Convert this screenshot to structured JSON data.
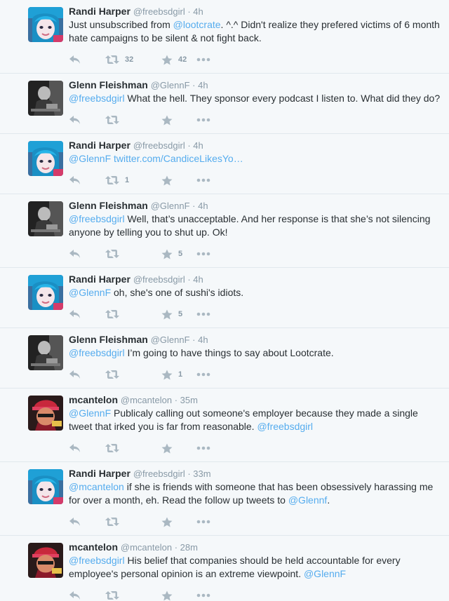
{
  "tweets": [
    {
      "name": "Randi Harper",
      "handle": "@freebsdgirl",
      "time": "4h",
      "avatar": "randi",
      "segments": [
        {
          "t": "Just unsubscribed from "
        },
        {
          "t": "@lootcrate",
          "link": true
        },
        {
          "t": ".  ^.^ Didn't realize they prefered victims of 6 month hate campaigns to be silent & not fight back."
        }
      ],
      "retweets": "32",
      "favorites": "42"
    },
    {
      "name": "Glenn Fleishman",
      "handle": "@GlennF",
      "time": "4h",
      "avatar": "glenn",
      "segments": [
        {
          "t": "@freebsdgirl",
          "link": true
        },
        {
          "t": " What the hell. They sponsor every podcast I listen to. What did they do?"
        }
      ],
      "retweets": "",
      "favorites": ""
    },
    {
      "name": "Randi Harper",
      "handle": "@freebsdgirl",
      "time": "4h",
      "avatar": "randi",
      "segments": [
        {
          "t": "@GlennF",
          "link": true
        },
        {
          "t": " "
        },
        {
          "t": "twitter.com/CandiceLikesYo…",
          "link": true
        }
      ],
      "retweets": "1",
      "favorites": ""
    },
    {
      "name": "Glenn Fleishman",
      "handle": "@GlennF",
      "time": "4h",
      "avatar": "glenn",
      "segments": [
        {
          "t": "@freebsdgirl",
          "link": true
        },
        {
          "t": " Well, that’s unacceptable. And her response is that she’s not silencing anyone by telling you to shut up. Ok!"
        }
      ],
      "retweets": "",
      "favorites": "5"
    },
    {
      "name": "Randi Harper",
      "handle": "@freebsdgirl",
      "time": "4h",
      "avatar": "randi",
      "segments": [
        {
          "t": "@GlennF",
          "link": true
        },
        {
          "t": " oh, she's one of sushi's idiots."
        }
      ],
      "retweets": "",
      "favorites": "5"
    },
    {
      "name": "Glenn Fleishman",
      "handle": "@GlennF",
      "time": "4h",
      "avatar": "glenn",
      "segments": [
        {
          "t": "@freebsdgirl",
          "link": true
        },
        {
          "t": " I’m going to have things to say about Lootcrate."
        }
      ],
      "retweets": "",
      "favorites": "1"
    },
    {
      "name": "mcantelon",
      "handle": "@mcantelon",
      "time": "35m",
      "avatar": "mcantelon",
      "segments": [
        {
          "t": "@GlennF",
          "link": true
        },
        {
          "t": " Publicaly calling out someone's employer because they made a single tweet that irked you is far from reasonable. "
        },
        {
          "t": "@freebsdgirl",
          "link": true
        }
      ],
      "retweets": "",
      "favorites": ""
    },
    {
      "name": "Randi Harper",
      "handle": "@freebsdgirl",
      "time": "33m",
      "avatar": "randi",
      "segments": [
        {
          "t": "@mcantelon",
          "link": true
        },
        {
          "t": " if she is friends with someone that has been obsessively harassing me for over a month, eh. Read the follow up tweets to "
        },
        {
          "t": "@Glennf",
          "link": true
        },
        {
          "t": "."
        }
      ],
      "retweets": "",
      "favorites": ""
    },
    {
      "name": "mcantelon",
      "handle": "@mcantelon",
      "time": "28m",
      "avatar": "mcantelon",
      "segments": [
        {
          "t": "@freebsdgirl",
          "link": true
        },
        {
          "t": " His belief that companies should be held accountable for every employee's personal opinion is an extreme viewpoint. "
        },
        {
          "t": "@GlennF",
          "link": true
        }
      ],
      "retweets": "",
      "favorites": ""
    }
  ],
  "ui": {
    "separator": " · ",
    "colors": {
      "link": "#55acee",
      "muted": "#8899a6",
      "icon": "#aab8c2",
      "background": "#f5f8fa"
    },
    "icons": {
      "reply": "reply-icon",
      "retweet": "retweet-icon",
      "favorite": "star-icon",
      "more": "more-icon"
    }
  }
}
